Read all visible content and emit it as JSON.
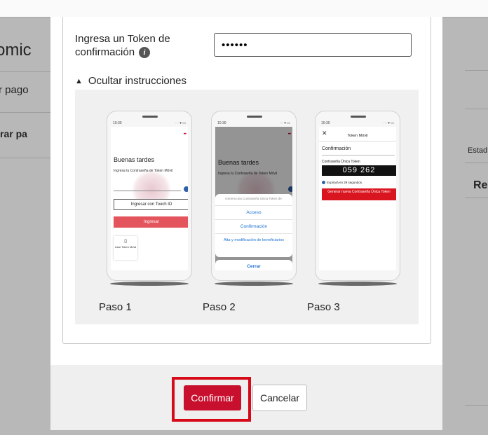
{
  "background": {
    "left_texts": [
      "omic",
      "r pago",
      "rar pa"
    ],
    "right_texts": [
      "Estad",
      "Rea"
    ]
  },
  "token": {
    "label": "Ingresa un Token de confirmación",
    "info_icon_glyph": "i",
    "masked_value": "••••••"
  },
  "instructions": {
    "toggle_label": "Ocultar instrucciones",
    "toggle_icon": "chevron-up-icon",
    "steps": [
      {
        "label": "Paso 1",
        "phone": {
          "time": "10:30",
          "status": "⋯ ▾ ▭",
          "menu": "•••",
          "greeting": "Buenas tardes",
          "subtitle": "Ingresa tu Contraseña de Token Móvil",
          "touch_id_button": "Ingresar con Touch ID",
          "enter_button": "Ingresar",
          "tile_icon": "▯",
          "tile_text": "Usar Token Móvil"
        }
      },
      {
        "label": "Paso 2",
        "phone": {
          "time": "10:30",
          "status": "⋯ ▾ ▭",
          "menu": "•••",
          "greeting": "Buenas tardes",
          "subtitle": "Ingresa tu Contraseña de Token Móvil",
          "sheet_caption": "Genera una Contraseña Única Token de:",
          "options": [
            "Acceso",
            "Confirmación",
            "Alta y modificación de beneficiarios"
          ],
          "cancel": "Cerrar"
        }
      },
      {
        "label": "Paso 3",
        "phone": {
          "time": "10:30",
          "status": "⋯ ▾ ▭",
          "close_glyph": "✕",
          "header": "Token Móvil",
          "title": "Confirmación",
          "code_label": "Contraseña Única Token",
          "code": "059 262",
          "expires": "Expirará en 29 segundos.",
          "generate_button": "Generar nueva Contraseña Única Token"
        }
      }
    ]
  },
  "footer": {
    "confirm_label": "Confirmar",
    "cancel_label": "Cancelar"
  },
  "colors": {
    "brand_red": "#c8102e",
    "highlight_red": "#d60a19"
  }
}
